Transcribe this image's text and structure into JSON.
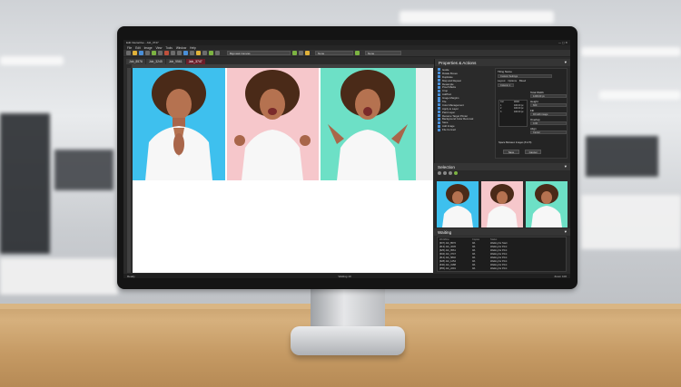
{
  "window": {
    "title": "Edit Interactive - Job_3747"
  },
  "menu": [
    "File",
    "Edit",
    "Image",
    "View",
    "Tools",
    "Window",
    "Help"
  ],
  "toolbar": {
    "view_select": "Bigmask Canvas",
    "mode_select": "None"
  },
  "tabs": [
    {
      "label": "Job_8576",
      "active": false
    },
    {
      "label": "Job_3245",
      "active": false
    },
    {
      "label": "Job_9561",
      "active": false
    },
    {
      "label": "Job_3747",
      "active": true
    }
  ],
  "properties": {
    "title": "Properties & Actions",
    "actions": [
      "Guide",
      "Rotate Boxes",
      "Duplicate",
      "Map and Repeat",
      "Resample",
      "Proof Marks",
      "Crop",
      "AddText",
      "Image Margins",
      "Tile",
      "Color Management",
      "Apply to Layer",
      "Paint Layer",
      "Rename Target Printer",
      "Background Color Removal",
      "Save",
      "Add Image",
      "File Convert"
    ],
    "options": {
      "heading": "Tiling Name",
      "preset": "Custom Settings",
      "tabs": [
        "Layout",
        "Options",
        "Bleed"
      ],
      "column_label": "Column 1",
      "columns_header": [
        "Col",
        "Width"
      ],
      "rows": [
        [
          "1",
          "400.00 px"
        ],
        [
          "2",
          "400.00 px"
        ],
        [
          "3",
          "400.00 px"
        ]
      ],
      "total_width_label": "Total Width",
      "total_width_value": "1200.00 px",
      "height_label": "Height",
      "height_value": "600",
      "mode_label": "Fill",
      "mode_value": "Fill with image",
      "overlap_label": "Overlap",
      "overlap_value": "0.00",
      "align_label": "Align",
      "align_value": "Center",
      "caption": "Space Between Images (8 of 8)",
      "ok_label": "Save",
      "cancel_label": "Cancel"
    }
  },
  "selection": {
    "title": "Selection"
  },
  "waiting": {
    "title": "Waiting",
    "columns": [
      "Workflow",
      "Copies",
      "Status"
    ],
    "rows": [
      [
        "[607] Job_8576",
        "0/1",
        "Waiting for Start"
      ],
      [
        "[613] Job_3245",
        "0/1",
        "Waiting for Print"
      ],
      [
        "[625] Job_9561",
        "0/1",
        "Waiting for Print"
      ],
      [
        "[604] Job_3747",
        "0/1",
        "Waiting for Print"
      ],
      [
        "[612] Job_5802",
        "0/1",
        "Waiting for Print"
      ],
      [
        "[628] Job_1254",
        "0/1",
        "Waiting for Print"
      ],
      [
        "[640] Job_3188",
        "0/1",
        "Waiting for Print"
      ],
      [
        "[655] Job_2291",
        "0/1",
        "Waiting for Print"
      ]
    ]
  },
  "status": {
    "left": "Ready",
    "waiting": "Waiting 10",
    "zoom": "Zoom 100"
  },
  "colors": {
    "panel1": "#3ec0ee",
    "panel2": "#f6c7cb",
    "panel3": "#6de0c6",
    "active_tab": "#6b1f2a"
  }
}
